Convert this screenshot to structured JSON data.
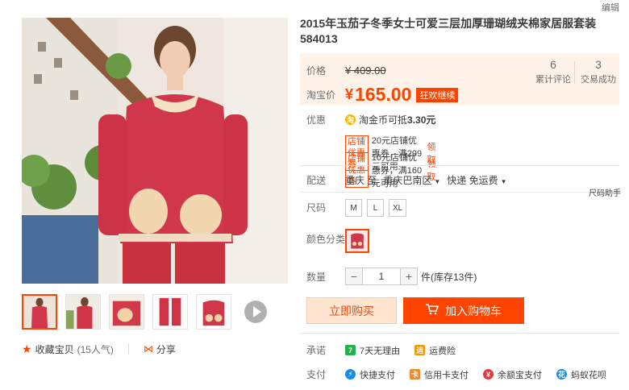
{
  "top": {
    "edit_label": "编辑"
  },
  "product": {
    "title": "2015年玉茄子冬季女士可爱三层加厚珊瑚绒夹棉家居服套装 584013"
  },
  "price": {
    "label": "价格",
    "original": "¥ 409.00",
    "tb_label": "淘宝价",
    "currency": "¥",
    "current": "165.00",
    "promo_tag": "狂欢继续"
  },
  "stats": {
    "reviews_count": "6",
    "reviews_label": "累计评论",
    "deals_count": "3",
    "deals_label": "交易成功"
  },
  "promo": {
    "label": "优惠",
    "coin_glyph": "淘",
    "coin_text": "淘金币可抵",
    "coin_amount": "3.30元",
    "coupons": [
      {
        "tag": "店铺优惠券",
        "text": "20元店铺优惠券，满299元可用",
        "get": "领取"
      },
      {
        "tag": "店铺优惠券",
        "text": "10元店铺优惠券，满160元可用",
        "get": "领取"
      }
    ]
  },
  "shipping": {
    "label": "配送",
    "from": "重庆 至",
    "to": "重庆巴南区",
    "method": "快递 免运费"
  },
  "size_help": "尺码助手",
  "size": {
    "label": "尺码",
    "options": [
      "M",
      "L",
      "XL"
    ]
  },
  "color": {
    "label": "颜色分类"
  },
  "quantity": {
    "label": "数量",
    "value": "1",
    "minus": "−",
    "plus": "+",
    "stock": "件(库存13件)"
  },
  "actions": {
    "buy_now": "立即购买",
    "add_cart": "加入购物车"
  },
  "promise": {
    "label": "承诺",
    "items": [
      {
        "icon": "7",
        "text": "7天无理由",
        "color": "#21b24c"
      },
      {
        "icon": "运",
        "text": "运费险",
        "color": "#f39800"
      }
    ]
  },
  "payment": {
    "label": "支付",
    "items": [
      {
        "icon": "⚡",
        "text": "快捷支付",
        "color": "#1a8de0"
      },
      {
        "icon": "卡",
        "text": "信用卡支付",
        "color": "#f08b35"
      },
      {
        "icon": "¥",
        "text": "余额宝支付",
        "color": "#e4393c"
      },
      {
        "icon": "花",
        "text": "蚂蚁花呗",
        "color": "#1a8de0"
      }
    ]
  },
  "left_actions": {
    "fav_label": "收藏宝贝",
    "fav_count": "(15人气)",
    "share_label": "分享"
  },
  "colors": {
    "accent": "#ff4400",
    "price_bg": "#fff2e8"
  }
}
